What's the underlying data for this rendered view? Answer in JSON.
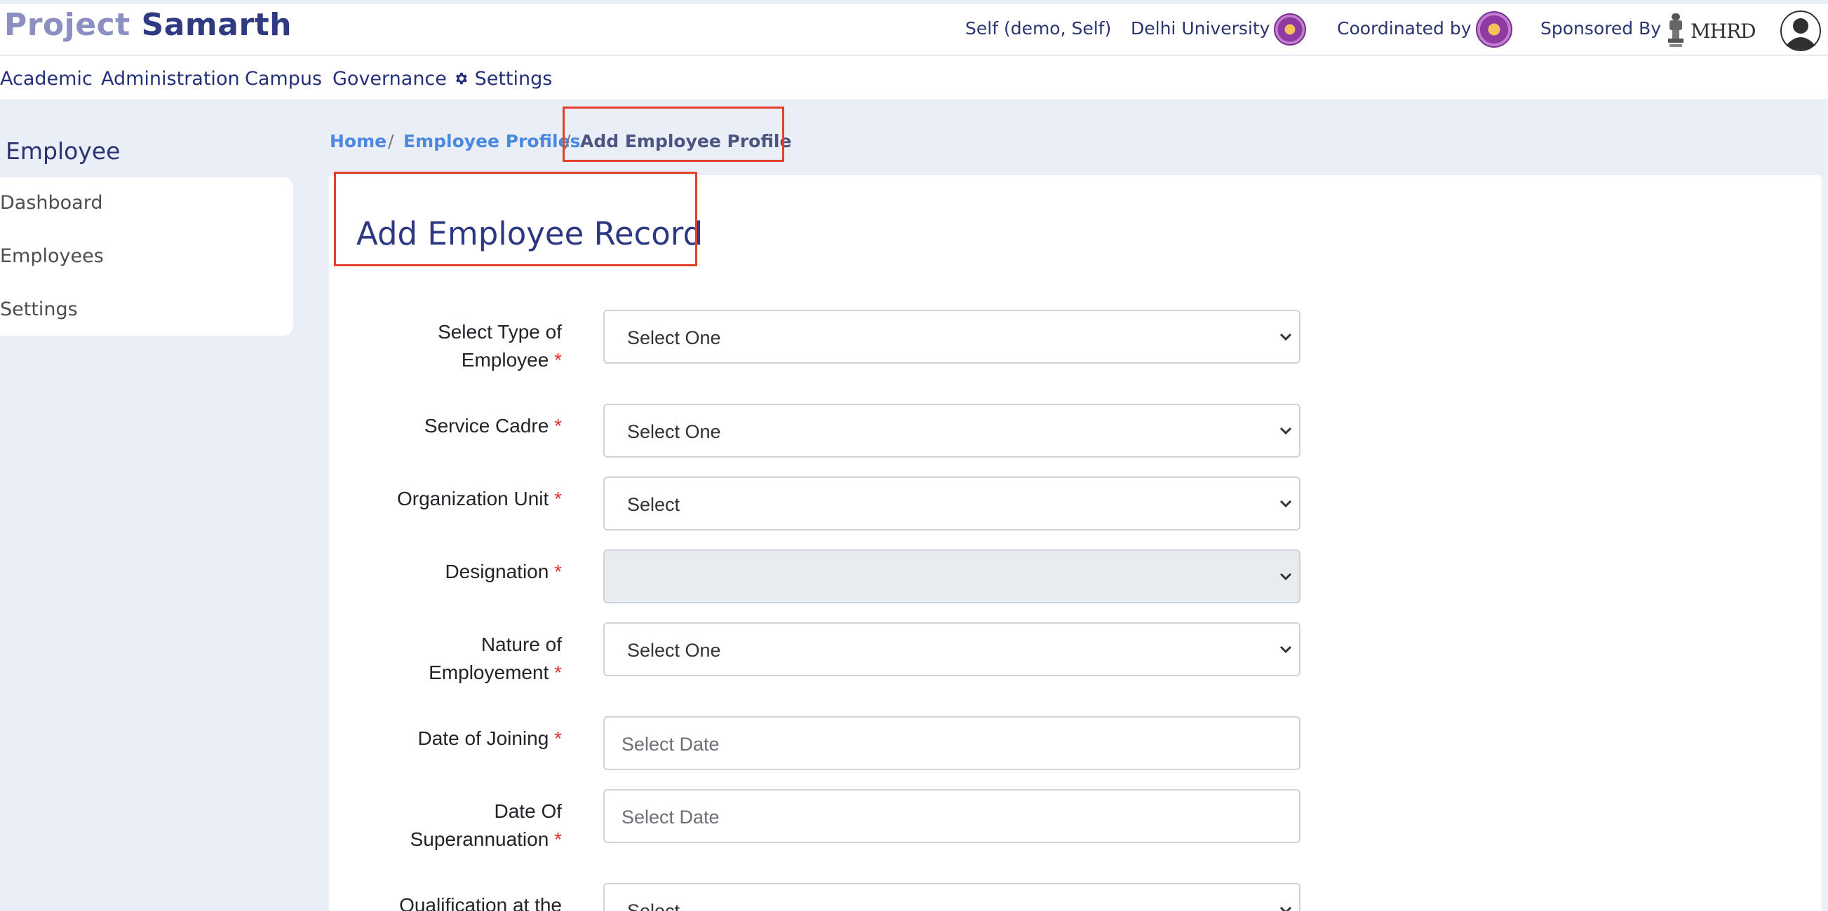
{
  "brand": {
    "part1": "Project",
    "part2": "Samarth"
  },
  "top_info": {
    "user": "Self (demo, Self)",
    "university": "Delhi University",
    "coordinated_by": "Coordinated by",
    "sponsored_by": "Sponsored By",
    "sponsor_logo_text": "MHRD"
  },
  "nav": {
    "items": [
      "Academic",
      "Administration",
      "Campus",
      "Governance",
      "Settings"
    ]
  },
  "sidebar": {
    "title": "Employee",
    "items": [
      "Dashboard",
      "Employees",
      "Settings"
    ]
  },
  "breadcrumb": {
    "home": "Home",
    "sep": "/",
    "profiles": "Employee Profiles",
    "current": "Add Employee Profile"
  },
  "page": {
    "title": "Add Employee Record"
  },
  "form": {
    "required_mark": "*",
    "fields": [
      {
        "label_line1": "Select Type of",
        "label_line2": "Employee",
        "value": "Select One"
      },
      {
        "label_line1": "Service Cadre",
        "value": "Select One"
      },
      {
        "label_line1": "Organization Unit",
        "value": "Select"
      },
      {
        "label_line1": "Designation",
        "value": ""
      },
      {
        "label_line1": "Nature of",
        "label_line2": "Employement",
        "value": "Select One"
      },
      {
        "label_line1": "Date of Joining",
        "placeholder": "Select Date"
      },
      {
        "label_line1": "Date Of",
        "label_line2": "Superannuation",
        "placeholder": "Select Date"
      },
      {
        "label_line1": "Qualification at the",
        "value": "Select"
      }
    ]
  },
  "colors": {
    "accent": "#2d3882",
    "link": "#4b88e0",
    "highlight": "#e1402c",
    "required": "#e23030",
    "background": "#e9eef7"
  }
}
